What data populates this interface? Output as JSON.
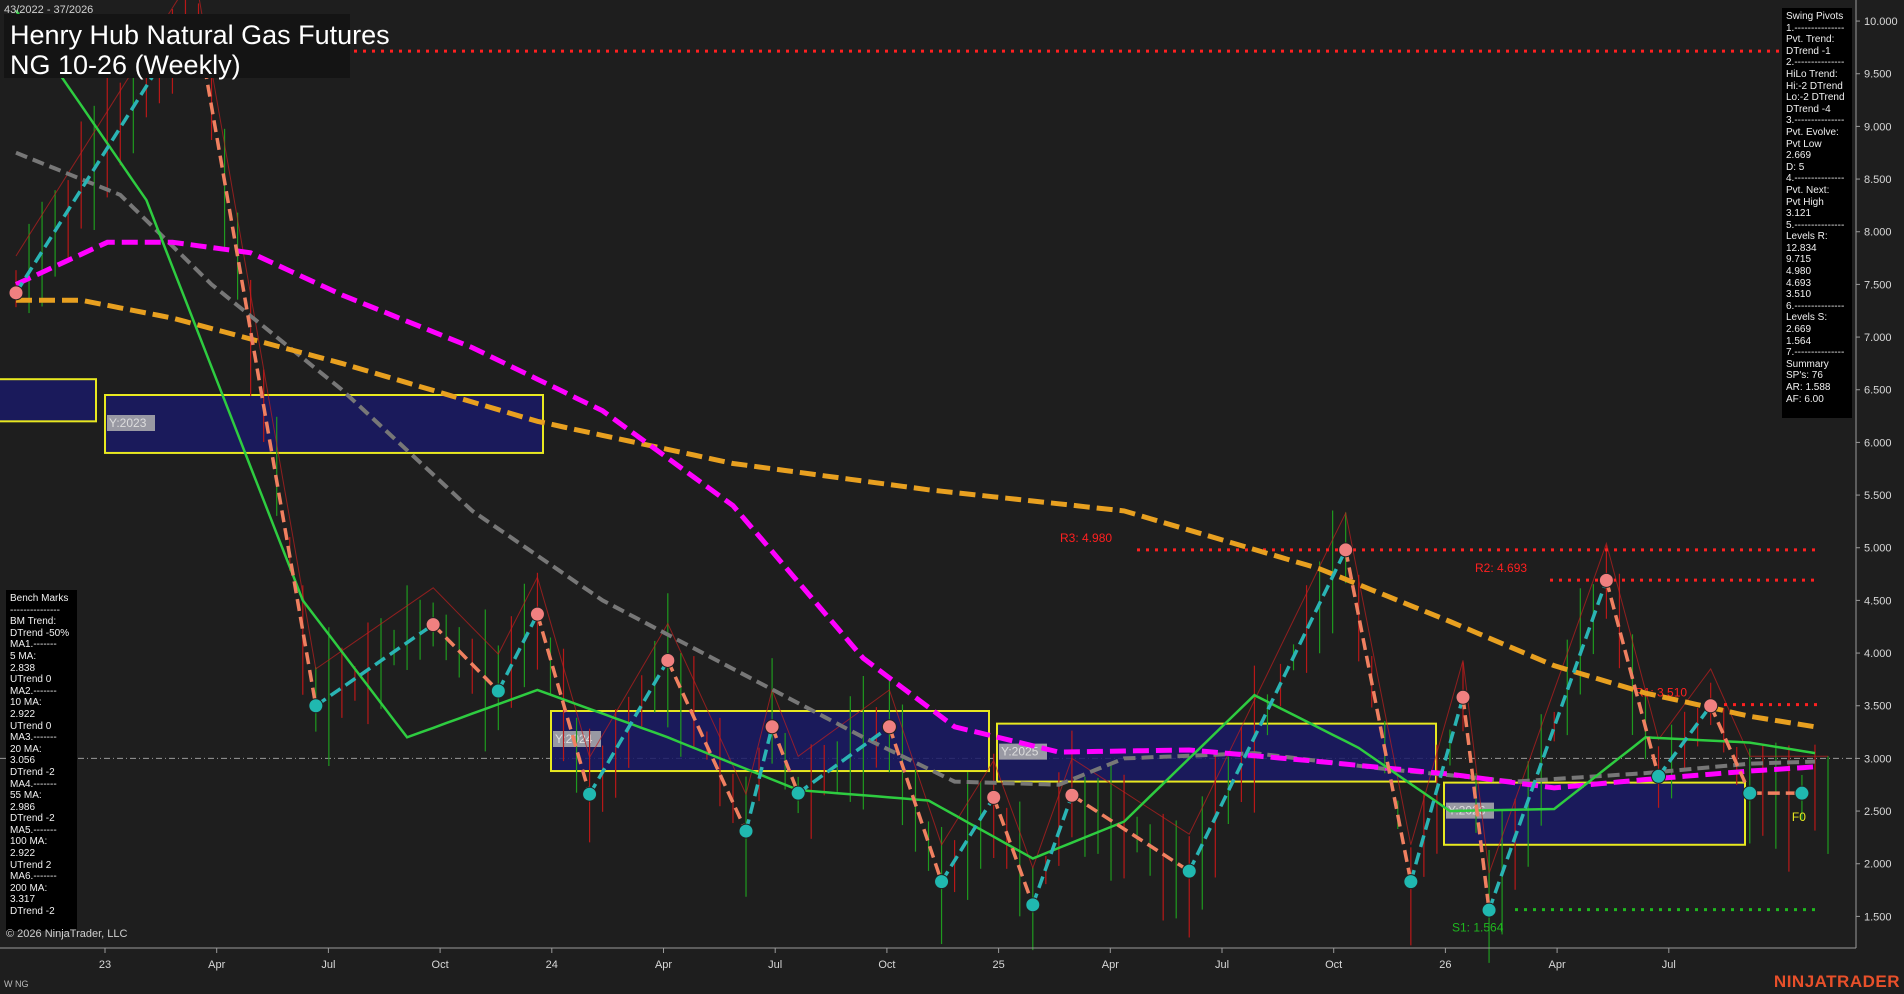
{
  "header": {
    "date_range": "43/2022 - 37/2026",
    "title": "Henry Hub Natural Gas Futures",
    "subtitle": "NG 10-26 (Weekly)"
  },
  "swing_pivots": [
    "Swing Pivots",
    "1.---------------",
    "Pvt. Trend:",
    "DTrend -1",
    "2.---------------",
    "HiLo Trend:",
    "Hi:-2 DTrend",
    "Lo:-2 DTrend",
    "DTrend -4",
    "3.---------------",
    "Pvt. Evolve:",
    "Pvt Low",
    "2.669",
    "D: 5",
    "4.---------------",
    "Pvt. Next:",
    "Pvt High",
    "3.121",
    "5.---------------",
    "Levels R:",
    "12.834",
    "9.715",
    "4.980",
    "4.693",
    "3.510",
    "6.---------------",
    "Levels S:",
    "2.669",
    "1.564",
    "7.---------------",
    "Summary",
    "SP's: 76",
    "AR: 1.588",
    "AF: 6.00"
  ],
  "bench_marks": [
    "Bench Marks",
    "---------------",
    "BM Trend:",
    "DTrend -50%",
    "MA1.-------",
    "5 MA:",
    "2.838",
    "UTrend 0",
    "MA2.-------",
    "10 MA:",
    "2.922",
    "UTrend 0",
    "MA3.-------",
    "20 MA:",
    "3.056",
    "DTrend -2",
    "MA4.-------",
    "55 MA:",
    "2.986",
    "DTrend -2",
    "MA5.-------",
    "100 MA:",
    "2.922",
    "UTrend 2",
    "MA6.-------",
    "200 MA:",
    "3.317",
    "DTrend -2"
  ],
  "footer": {
    "copyright": "© 2026 NinjaTrader, LLC",
    "instrument": "W NG",
    "brand": "NINJATRADER"
  },
  "colors": {
    "background": "#1e1e1e",
    "ma_green": "#2ecc40",
    "ma_magenta": "#ff00ff",
    "ma_orange": "#e8a020",
    "ma_gray": "#777777",
    "pivot_up": "#2ab4b4",
    "pivot_down": "#f08060",
    "resistance": "#ff2020",
    "support": "#1fb81f",
    "year_box": "#1a1a66",
    "year_box_border": "#e8e820"
  },
  "chart_data": {
    "type": "line",
    "ylim": [
      1.2,
      10.2
    ],
    "y_ticks": [
      "10.000",
      "9.500",
      "9.000",
      "8.500",
      "8.000",
      "7.500",
      "7.000",
      "6.500",
      "6.000",
      "5.500",
      "5.000",
      "4.500",
      "4.000",
      "3.500",
      "3.000",
      "2.500",
      "2.000",
      "1.500"
    ],
    "x_ticks": [
      "23",
      "Apr",
      "Jul",
      "Oct",
      "24",
      "Apr",
      "Jul",
      "Oct",
      "25",
      "Apr",
      "Jul",
      "Oct",
      "26",
      "Apr",
      "Jul"
    ],
    "levels": [
      {
        "label": "R3: 4.980",
        "value": 4.98,
        "kind": "resistance"
      },
      {
        "label": "R2: 4.693",
        "value": 4.693,
        "kind": "resistance"
      },
      {
        "label": "R1: 3.510",
        "value": 3.51,
        "kind": "resistance"
      },
      {
        "label": "S1: 1.564",
        "value": 1.564,
        "kind": "support"
      },
      {
        "label": "",
        "value": 9.715,
        "kind": "resistance"
      }
    ],
    "year_boxes": [
      {
        "label": "Y:2023",
        "high": 6.45,
        "low": 5.9
      },
      {
        "label": "Y:2024",
        "high": 3.45,
        "low": 2.88
      },
      {
        "label": "Y:2025",
        "high": 3.33,
        "low": 2.78
      },
      {
        "label": "Y:2026",
        "high": 2.77,
        "low": 2.18
      }
    ],
    "current_marker": "F0",
    "series": [
      {
        "name": "",
        "kind": "pivots",
        "x": [
          0,
          13,
          14,
          23,
          32,
          37,
          40,
          44,
          50,
          56,
          58,
          60,
          67,
          71,
          75,
          78,
          81,
          90,
          102,
          107,
          111,
          113,
          122,
          126,
          130,
          133,
          137
        ],
        "values": [
          7.42,
          9.97,
          9.9,
          3.5,
          4.27,
          3.64,
          4.37,
          2.66,
          3.93,
          2.31,
          3.3,
          2.67,
          3.3,
          1.83,
          2.63,
          1.61,
          2.65,
          1.93,
          4.98,
          1.83,
          3.58,
          1.56,
          4.69,
          2.83,
          3.5,
          2.67,
          2.67
        ]
      },
      {
        "name": "",
        "kind": "ma-green",
        "x": [
          0,
          10,
          22,
          30,
          40,
          50,
          60,
          70,
          78,
          85,
          95,
          103,
          110,
          118,
          125,
          133,
          138
        ],
        "values": [
          10.1,
          8.3,
          4.5,
          3.2,
          3.65,
          3.2,
          2.7,
          2.6,
          2.05,
          2.4,
          3.6,
          3.1,
          2.5,
          2.52,
          3.2,
          3.15,
          3.05
        ]
      },
      {
        "name": "",
        "kind": "ma-magenta",
        "x": [
          0,
          7,
          12,
          18,
          25,
          35,
          45,
          55,
          65,
          72,
          80,
          90,
          100,
          110,
          118,
          125,
          133,
          138
        ],
        "values": [
          7.5,
          7.9,
          7.9,
          7.8,
          7.4,
          6.9,
          6.3,
          5.4,
          3.95,
          3.3,
          3.06,
          3.08,
          2.97,
          2.85,
          2.72,
          2.8,
          2.88,
          2.92
        ]
      },
      {
        "name": "",
        "kind": "ma-orange",
        "x": [
          0,
          5,
          12,
          25,
          40,
          55,
          70,
          85,
          100,
          110,
          118,
          125,
          133,
          138
        ],
        "values": [
          7.35,
          7.35,
          7.18,
          6.75,
          6.2,
          5.8,
          5.55,
          5.35,
          4.8,
          4.3,
          3.88,
          3.62,
          3.4,
          3.3
        ]
      },
      {
        "name": "",
        "kind": "ma-gray",
        "x": [
          0,
          8,
          15,
          25,
          35,
          45,
          55,
          65,
          72,
          80,
          85,
          95,
          105,
          115,
          125,
          133,
          138
        ],
        "values": [
          8.75,
          8.35,
          7.5,
          6.5,
          5.35,
          4.5,
          3.85,
          3.2,
          2.78,
          2.75,
          3.0,
          3.05,
          2.9,
          2.78,
          2.86,
          2.95,
          2.97
        ]
      }
    ]
  }
}
